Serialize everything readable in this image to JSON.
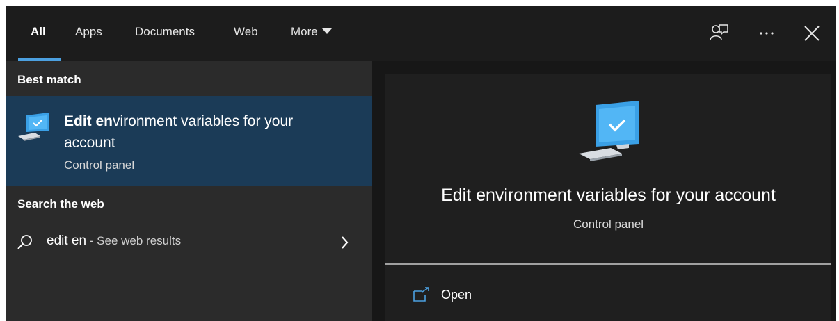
{
  "tabs": [
    {
      "label": "All"
    },
    {
      "label": "Apps"
    },
    {
      "label": "Documents"
    },
    {
      "label": "Web"
    },
    {
      "label": "More"
    }
  ],
  "header_icons": [
    "feedback-icon",
    "more-options-icon",
    "close-icon"
  ],
  "left": {
    "best_match_heading": "Best match",
    "best_match": {
      "title_bold": "Edit en",
      "title_rest": "vironment variables for your account",
      "subtitle": "Control panel"
    },
    "web_heading": "Search the web",
    "web_result": {
      "query": "edit en",
      "suffix": " - See web results"
    }
  },
  "detail": {
    "title": "Edit environment variables for your account",
    "subtitle": "Control panel",
    "actions": [
      {
        "label": "Open"
      }
    ]
  },
  "colors": {
    "accent": "#4ca0e0",
    "selected_row": "#1b3b57",
    "background": "#1f1f1f"
  }
}
